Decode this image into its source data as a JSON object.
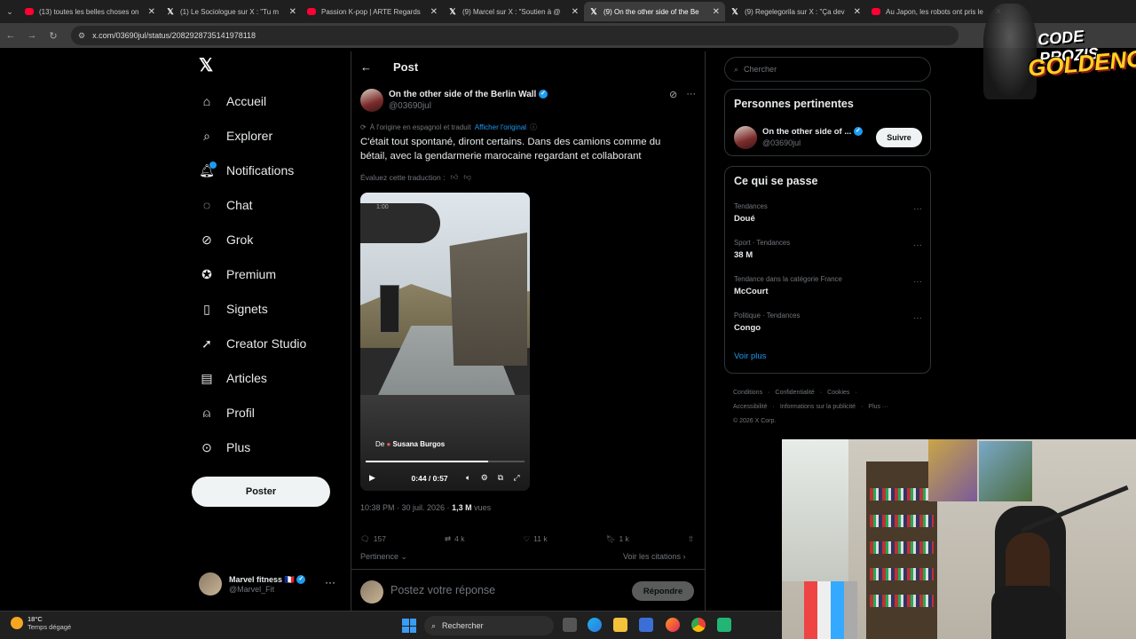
{
  "browser": {
    "tabs": [
      {
        "icon": "youtube-icon",
        "title": "(13) toutes les belles choses on",
        "active": false
      },
      {
        "icon": "x-icon",
        "title": "(1) Le Sociologue sur X : \"Tu m",
        "active": false
      },
      {
        "icon": "youtube-icon",
        "title": "Passion K-pop | ARTE Regards",
        "active": false
      },
      {
        "icon": "x-icon",
        "title": "(9) Marcel sur X : \"Soutien à @",
        "active": false
      },
      {
        "icon": "x-icon",
        "title": "(9) On the other side of the Be",
        "active": true
      },
      {
        "icon": "x-icon",
        "title": "(9) Regelegorila sur X : \"Ça dev",
        "active": false
      },
      {
        "icon": "youtube-icon",
        "title": "Au Japon, les robots ont pris le",
        "active": false
      }
    ],
    "url": "x.com/03690jul/status/2082928735141978118"
  },
  "nav": {
    "items": [
      {
        "label": "Accueil",
        "icon": "home-icon"
      },
      {
        "label": "Explorer",
        "icon": "search-icon"
      },
      {
        "label": "Notifications",
        "icon": "bell-icon"
      },
      {
        "label": "Chat",
        "icon": "chat-icon"
      },
      {
        "label": "Grok",
        "icon": "grok-icon"
      },
      {
        "label": "Premium",
        "icon": "premium-icon"
      },
      {
        "label": "Signets",
        "icon": "bookmark-icon"
      },
      {
        "label": "Creator Studio",
        "icon": "rocket-icon"
      },
      {
        "label": "Articles",
        "icon": "article-icon"
      },
      {
        "label": "Profil",
        "icon": "person-icon"
      },
      {
        "label": "Plus",
        "icon": "more-circle-icon"
      }
    ],
    "post_button": "Poster",
    "account": {
      "name": "Marvel fitness",
      "flag": "🇫🇷",
      "handle": "@Marvel_Fit"
    }
  },
  "post": {
    "header": "Post",
    "author": {
      "name": "On the other side of the Berlin Wall",
      "handle": "@03690jul"
    },
    "translation_note": "À l'origine en espagnol et traduit",
    "show_original": "Afficher l'original",
    "text": "C'était tout spontané, diront certains. Dans des camions comme du bétail, avec la gendarmerie marocaine regardant et collaborant",
    "rate_translation": "Évaluez cette traduction :",
    "video": {
      "overlay_time": "1:00",
      "credit_prefix": "De",
      "credit_name": "Susana Burgos",
      "time": "0:44 / 0:57",
      "progress": 0.77
    },
    "meta": {
      "time": "10:38 PM · 30 juil. 2026 · ",
      "views": "1,3 M",
      "views_label": " vues"
    },
    "stats": {
      "replies": "157",
      "reposts": "4 k",
      "likes": "11 k",
      "bookmarks": "1 k"
    },
    "sort_label": "Pertinence",
    "quotes_label": "Voir les citations",
    "reply_placeholder": "Postez votre réponse",
    "reply_button": "Répondre"
  },
  "sidebar": {
    "search_placeholder": "Chercher",
    "relevant_title": "Personnes pertinentes",
    "relevant": {
      "name": "On the other side of ...",
      "handle": "@03690jul",
      "follow": "Suivre"
    },
    "trends_title": "Ce qui se passe",
    "trends": [
      {
        "category": "Tendances",
        "name": "Doué"
      },
      {
        "category": "Sport · Tendances",
        "name": "38 M"
      },
      {
        "category": "Tendance dans la catégorie France",
        "name": "McCourt"
      },
      {
        "category": "Politique · Tendances",
        "name": "Congo"
      }
    ],
    "see_more": "Voir plus",
    "footer": {
      "line1": [
        "Conditions",
        "·",
        "Confidentialité",
        "·",
        "Cookies",
        "·"
      ],
      "line2": [
        "Accessibilité",
        "·",
        "Informations sur la publicité",
        "·",
        "Plus ···"
      ],
      "line3": "© 2026 X Corp."
    }
  },
  "overlay": {
    "line1": "CODE PROZIS",
    "line2": "GOLDENG"
  },
  "taskbar": {
    "temperature": "18°C",
    "weather": "Temps dégagé",
    "search": "Rechercher"
  },
  "colors": {
    "accent": "#1d9bf0",
    "background": "#000000",
    "text": "#e7e9ea",
    "muted": "#71767b"
  }
}
